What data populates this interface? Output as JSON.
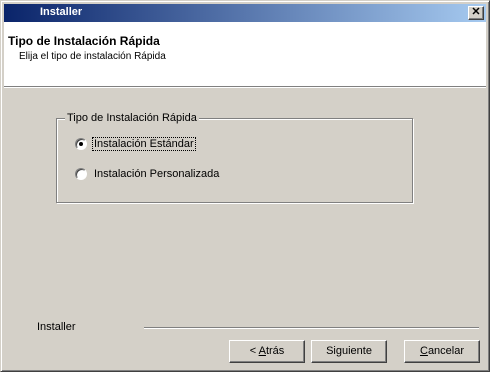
{
  "window": {
    "title": "Installer",
    "close_glyph": "✕"
  },
  "header": {
    "title": "Tipo de Instalación Rápida",
    "subtitle": "Elija el tipo de instalación Rápida"
  },
  "group": {
    "legend": "Tipo de Instalación Rápida",
    "options": [
      {
        "label": "Instalación Estándar",
        "selected": true
      },
      {
        "label": "Instalación Personalizada",
        "selected": false
      }
    ]
  },
  "footer": {
    "brand_label": "Installer"
  },
  "buttons": {
    "back_prefix": "< ",
    "back_accel": "A",
    "back_rest": "trás",
    "next_label": "Siguiente",
    "cancel_accel": "C",
    "cancel_rest": "ancelar"
  }
}
